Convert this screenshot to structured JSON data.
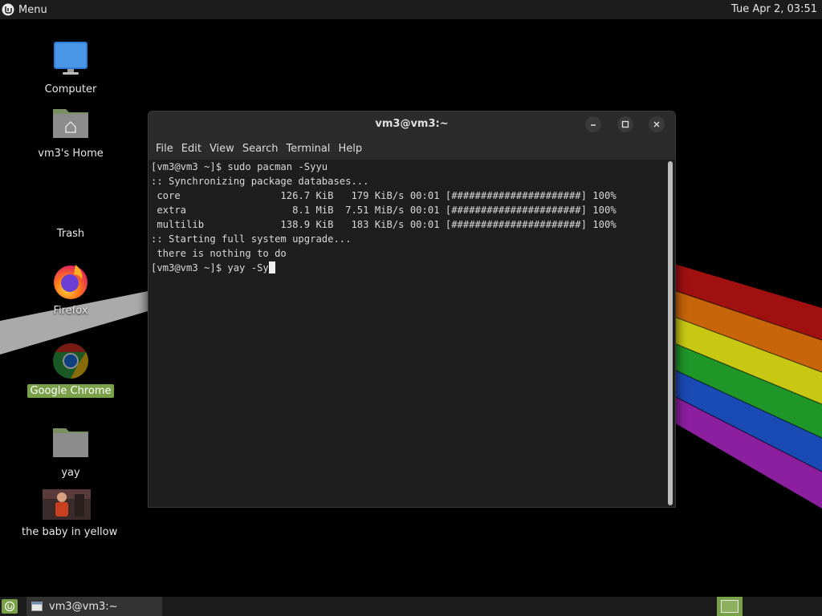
{
  "top_panel": {
    "menu_label": "Menu",
    "clock": "Tue Apr  2, 03:51"
  },
  "desktop": {
    "icons": [
      {
        "label": "Computer",
        "icon": "computer-icon"
      },
      {
        "label": "vm3's Home",
        "icon": "home-folder-icon"
      },
      {
        "label": "Trash",
        "icon": "trash-icon"
      },
      {
        "label": "Firefox",
        "icon": "firefox-icon"
      },
      {
        "label": "Google Chrome",
        "icon": "chrome-icon",
        "selected": true
      },
      {
        "label": "yay",
        "icon": "folder-icon"
      },
      {
        "label": "the baby in yellow",
        "icon": "game-thumbnail-icon"
      }
    ]
  },
  "terminal": {
    "title": "vm3@vm3:~",
    "menus": [
      "File",
      "Edit",
      "View",
      "Search",
      "Terminal",
      "Help"
    ],
    "lines": [
      "[vm3@vm3 ~]$ sudo pacman -Syyu",
      ":: Synchronizing package databases...",
      " core                 126.7 KiB   179 KiB/s 00:01 [######################] 100%",
      " extra                  8.1 MiB  7.51 MiB/s 00:01 [######################] 100%",
      " multilib             138.9 KiB   183 KiB/s 00:01 [######################] 100%",
      ":: Starting full system upgrade...",
      " there is nothing to do"
    ],
    "prompt_line": "[vm3@vm3 ~]$ yay -Sy"
  },
  "taskbar": {
    "window_label": "vm3@vm3:~"
  },
  "colors": {
    "accent": "#7aa14a",
    "panel": "#1c1c1c",
    "terminal_bg": "#1e1e1e"
  }
}
